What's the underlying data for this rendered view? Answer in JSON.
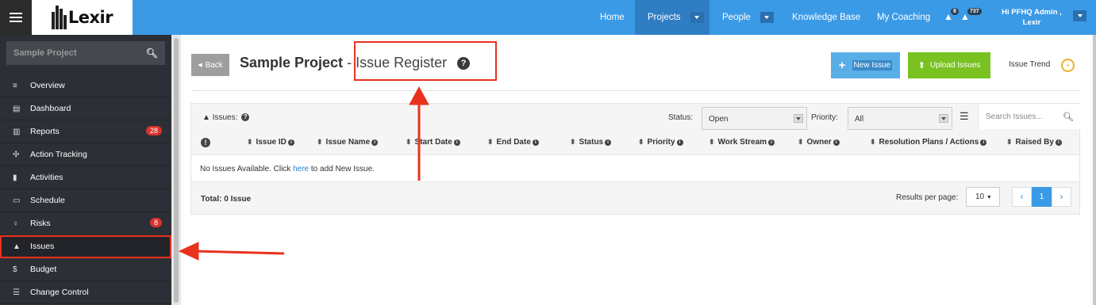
{
  "topbar": {
    "logo_text": "Lexir",
    "nav": [
      {
        "label": "Home"
      },
      {
        "label": "Projects"
      },
      {
        "label": "People"
      },
      {
        "label": "Knowledge Base"
      },
      {
        "label": "My Coaching"
      }
    ],
    "alerts_count": "8",
    "notifications_count": "737",
    "user_greeting": "Hi PFHQ Admin ,",
    "user_name": "Lexir"
  },
  "sidebar": {
    "search_value": "Sample Project",
    "items": [
      {
        "label": "Overview",
        "icon": "list-icon"
      },
      {
        "label": "Dashboard",
        "icon": "dashboard-icon"
      },
      {
        "label": "Reports",
        "icon": "bar-chart-icon",
        "count": "28"
      },
      {
        "label": "Action Tracking",
        "icon": "crosshair-icon"
      },
      {
        "label": "Activities",
        "icon": "bookmark-icon"
      },
      {
        "label": "Schedule",
        "icon": "calendar-icon"
      },
      {
        "label": "Risks",
        "icon": "lightbulb-icon",
        "count": "8"
      },
      {
        "label": "Issues",
        "icon": "warning-icon"
      },
      {
        "label": "Budget",
        "icon": "dollar-icon"
      },
      {
        "label": "Change Control",
        "icon": "sliders-icon"
      }
    ]
  },
  "header": {
    "back_label": "Back",
    "project_name": "Sample Project",
    "page_subtitle": "- Issue Register",
    "new_issue_label": "New Issue",
    "upload_issues_label": "Upload Issues",
    "issue_trend_label": "Issue Trend"
  },
  "filters": {
    "issues_label": "Issues:",
    "status_label": "Status:",
    "status_value": "Open",
    "priority_label": "Priority:",
    "priority_value": "All",
    "search_placeholder": "Search Issues..."
  },
  "table": {
    "columns": [
      "Issue ID",
      "Issue Name",
      "Start Date",
      "End Date",
      "Status",
      "Priority",
      "Work Stream",
      "Owner",
      "Resolution Plans / Actions",
      "Raised By"
    ],
    "empty_prefix": "No Issues Available. Click ",
    "empty_link": "here",
    "empty_suffix": " to add New Issue."
  },
  "footer": {
    "total_label": "Total: 0 Issue",
    "results_per_page_label": "Results per page:",
    "results_per_page_value": "10",
    "current_page": "1"
  },
  "colors": {
    "topbar": "#3a9ae6",
    "sidebar": "#2c2f36",
    "annotation": "#e8321e",
    "new_button": "#5aaee8",
    "upload_button": "#79c222",
    "badge": "#d8332d"
  }
}
